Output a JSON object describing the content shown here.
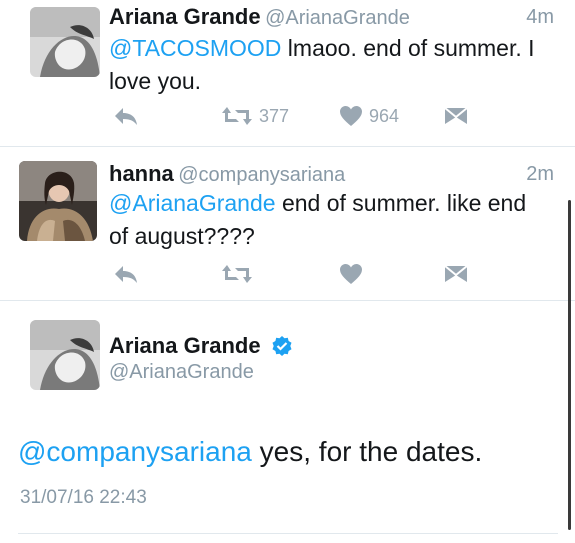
{
  "tweets": [
    {
      "name": "Ariana Grande",
      "handle": "@ArianaGrande",
      "time": "4m",
      "mention": "@TACOSMOOD",
      "text_line1_rest": " lmaoo. end of summer. I",
      "text_line2": "love you.",
      "retweets": "377",
      "likes": "964"
    },
    {
      "name": "hanna",
      "handle": "@companysariana",
      "time": "2m",
      "mention": "@ArianaGrande",
      "text_line1_rest": " end of summer. like end",
      "text_line2": "of august????"
    }
  ],
  "detail": {
    "name": "Ariana Grande",
    "handle": "@ArianaGrande",
    "mention": "@companysariana",
    "text_rest": " yes, for the dates.",
    "timestamp": "31/07/16 22:43"
  },
  "icons": {
    "reply": "reply-icon",
    "retweet": "retweet-icon",
    "like": "heart-icon",
    "dm": "direct-message-icon",
    "verified": "verified-badge-icon"
  },
  "colors": {
    "accent": "#1da1f2",
    "muted": "#8899a6",
    "icon": "#9aa7b2",
    "divider": "#e1e8ed"
  }
}
